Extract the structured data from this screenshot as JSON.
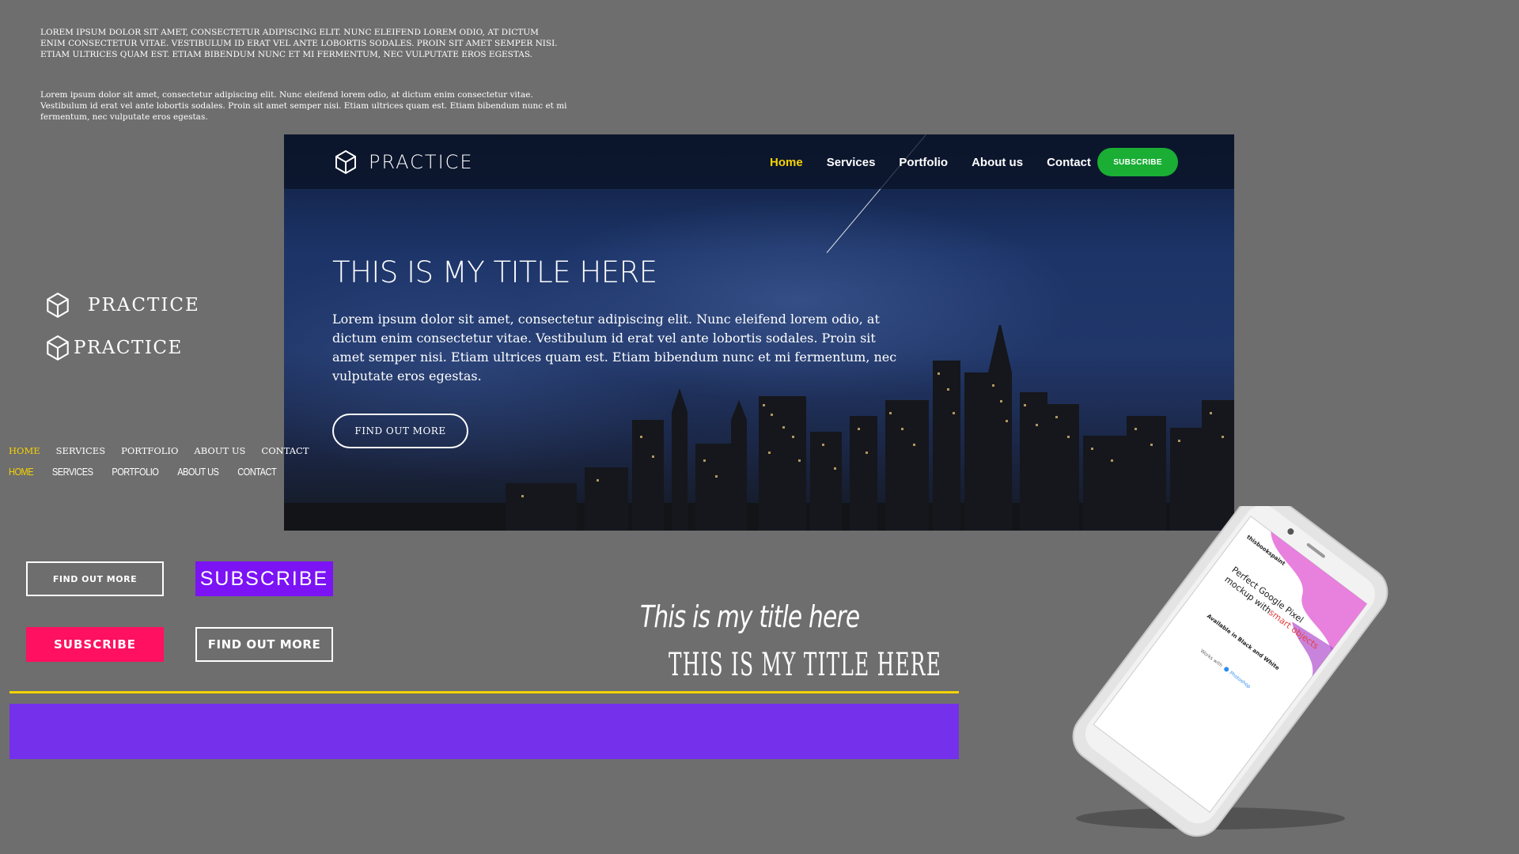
{
  "samples": {
    "caps_text": "Lorem ipsum dolor sit amet, consectetur adipiscing elit. Nunc eleifend lorem odio, at dictum enim consectetur vitae. Vestibulum id erat vel ante lobortis sodales. Proin sit amet semper nisi. Etiam ultrices quam est. Etiam bibendum nunc et mi fermentum, nec vulputate eros egestas.",
    "body_text": "Lorem ipsum dolor sit amet, consectetur adipiscing elit. Nunc eleifend lorem odio, at dictum enim consectetur vitae. Vestibulum id erat vel ante lobortis sodales. Proin sit amet semper nisi. Etiam ultrices quam est. Etiam bibendum nunc et mi fermentum, nec vulputate eros egestas."
  },
  "hero": {
    "brand": "PRACTICE",
    "nav": [
      "Home",
      "Services",
      "Portfolio",
      "About us",
      "Contact"
    ],
    "subscribe": "SUBSCRIBE",
    "title": "THIS IS MY TITLE HERE",
    "paragraph": "Lorem ipsum dolor sit amet, consectetur adipiscing elit. Nunc eleifend lorem odio, at dictum enim consectetur vitae. Vestibulum id erat vel ante lobortis sodales. Proin sit amet semper nisi. Etiam ultrices quam est. Etiam bibendum nunc et mi fermentum, nec vulputate eros egestas.",
    "cta": "FIND OUT MORE"
  },
  "logos": {
    "logo1": "PRACTICE",
    "logo2": "PRACTICE"
  },
  "nav_samples": {
    "nav1": [
      "HOME",
      "SERVICES",
      "PORTFOLIO",
      "ABOUT US",
      "CONTACT"
    ],
    "nav2": [
      "HOME",
      "SERVICES",
      "PORTFOLIO",
      "ABOUT US",
      "CONTACT"
    ]
  },
  "buttons": {
    "find_outline_small": "FIND OUT MORE",
    "subscribe_purple": "SUBSCRIBE",
    "subscribe_pink": "SUBSCRIBE",
    "find_outline_large": "FIND OUT MORE"
  },
  "titles": {
    "handwritten": "This is my title here",
    "caps": "THIS IS MY TITLE HERE"
  },
  "phone": {
    "brand": "thisbookspaint",
    "line1": "Perfect Google Pixel",
    "line2": "mockup with",
    "line2_accent": "smart objects",
    "line3": "Available in Black and White",
    "line4": "Works with",
    "line4_app": "Photoshop"
  },
  "colors": {
    "background": "#6e6e6e",
    "accent_yellow": "#f5d300",
    "subscribe_green": "#1aae35",
    "purple": "#7b13f5",
    "pink": "#ff1060",
    "purple_bar": "#7530ec"
  }
}
